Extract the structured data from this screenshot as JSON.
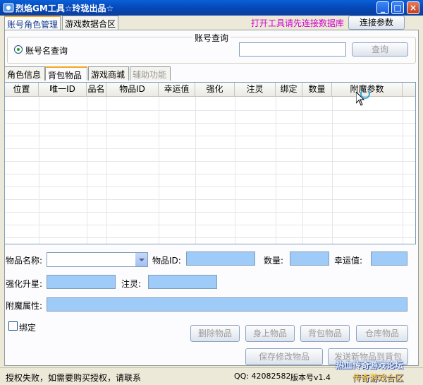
{
  "window": {
    "title": "烈焰GM工具☆玲珑出品☆",
    "buttons": [
      "_",
      "□",
      "×"
    ]
  },
  "top_tabs": [
    {
      "label": "账号角色管理",
      "active": true
    },
    {
      "label": "游戏数据合区",
      "active": false
    }
  ],
  "header": {
    "warning": "打开工具请先连接数据库",
    "connect_label": "连接参数"
  },
  "account_query": {
    "group_title": "账号查询",
    "radio_label": "账号名查询",
    "input_value": "",
    "query_label": "查询"
  },
  "inner_tabs": [
    {
      "label": "角色信息",
      "active": false
    },
    {
      "label": "背包物品",
      "active": true
    },
    {
      "label": "游戏商城",
      "active": false
    },
    {
      "label": "辅助功能",
      "active": false,
      "disabled": true
    }
  ],
  "grid": {
    "columns": [
      "位置",
      "唯一ID",
      "品名",
      "物品ID",
      "幸运值",
      "强化",
      "注灵",
      "绑定",
      "数量",
      "附魔参数"
    ]
  },
  "form": {
    "item_name_label": "物品名称:",
    "item_id_label": "物品ID:",
    "quantity_label": "数量:",
    "luck_label": "幸运值:",
    "enhance_label": "强化升星:",
    "spirit_label": "注灵:",
    "enchant_label": "附魔属性:",
    "bind_label": "绑定"
  },
  "actions": {
    "delete": "删除物品",
    "equip": "身上物品",
    "bag": "背包物品",
    "warehouse": "仓库物品",
    "save": "保存修改物品",
    "send": "发送新物品到背包"
  },
  "status": {
    "message": "授权失败，如需要购买授权，请联系",
    "qq": "QQ: 42082582",
    "version": "版本号v1.4"
  },
  "watermark": {
    "line1": "热血传奇游戏论坛",
    "line2": "传奇游戏合区"
  },
  "colors": {
    "title_blue": "#0548b8",
    "warning": "#cc00cc",
    "field_blue": "#9ecbf7",
    "active_tab": "#f5a623"
  }
}
